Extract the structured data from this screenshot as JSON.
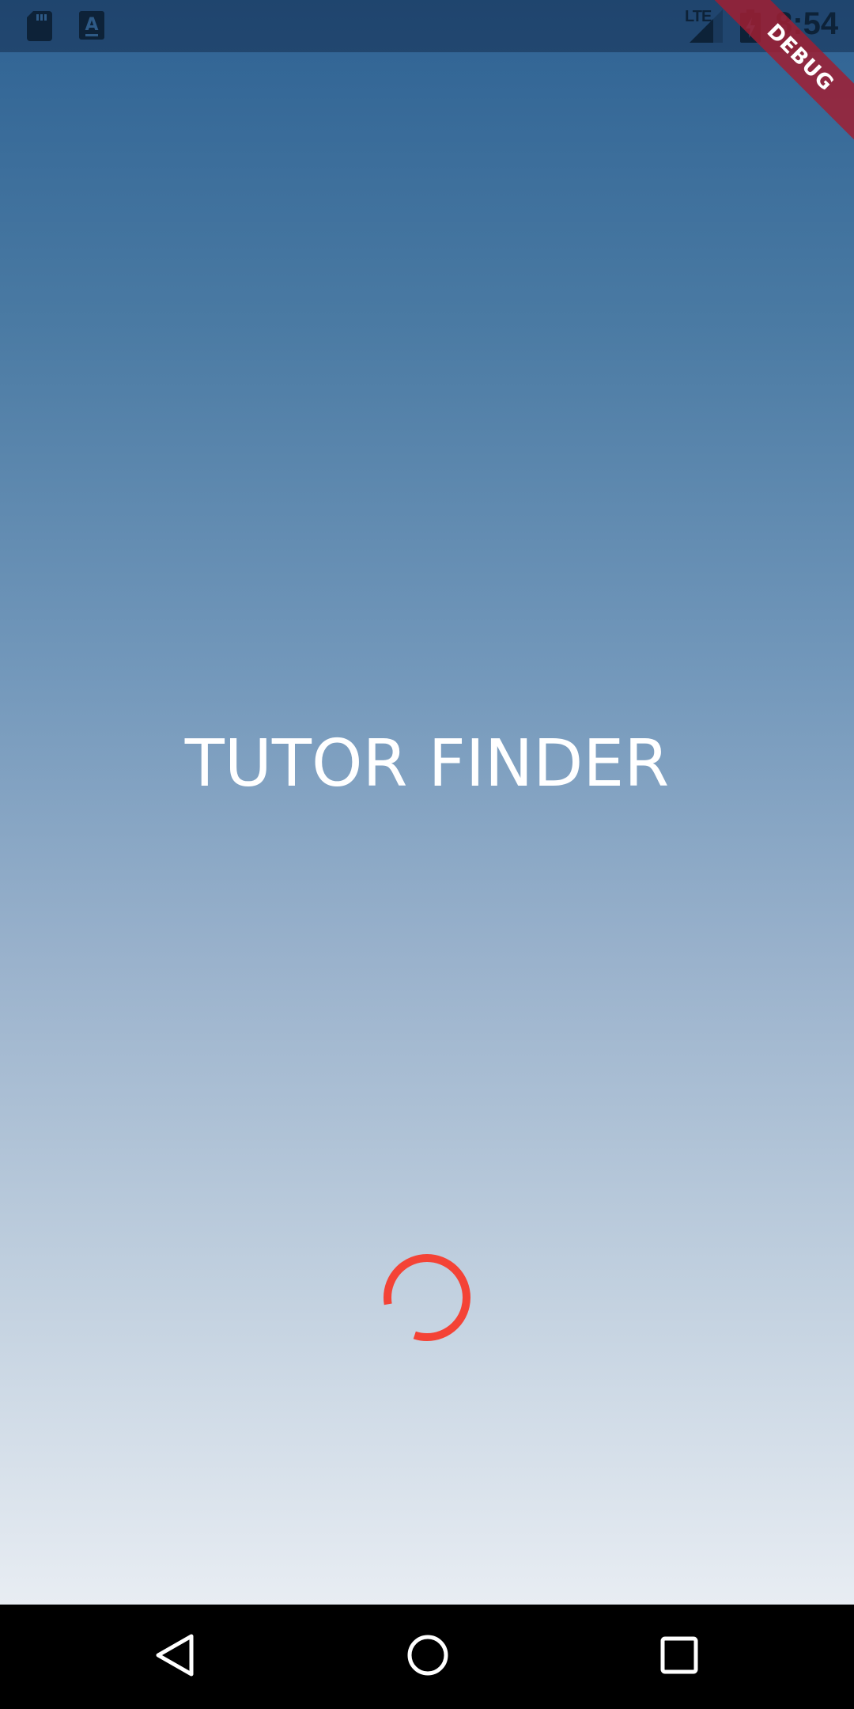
{
  "status_bar": {
    "icons": [
      "sd-card-icon",
      "accessibility-a-icon",
      "lte-signal-icon",
      "battery-charging-icon"
    ],
    "network_label": "LTE",
    "time": "8:54"
  },
  "debug_banner": {
    "label": "DEBUG",
    "color": "#a01e32"
  },
  "splash": {
    "title": "TUTOR FINDER",
    "spinner_color": "#f44336",
    "background_top": "#2e6293",
    "background_bottom": "#e8edf3"
  },
  "nav_bar": {
    "buttons": [
      "back-icon",
      "home-icon",
      "recents-icon"
    ]
  }
}
